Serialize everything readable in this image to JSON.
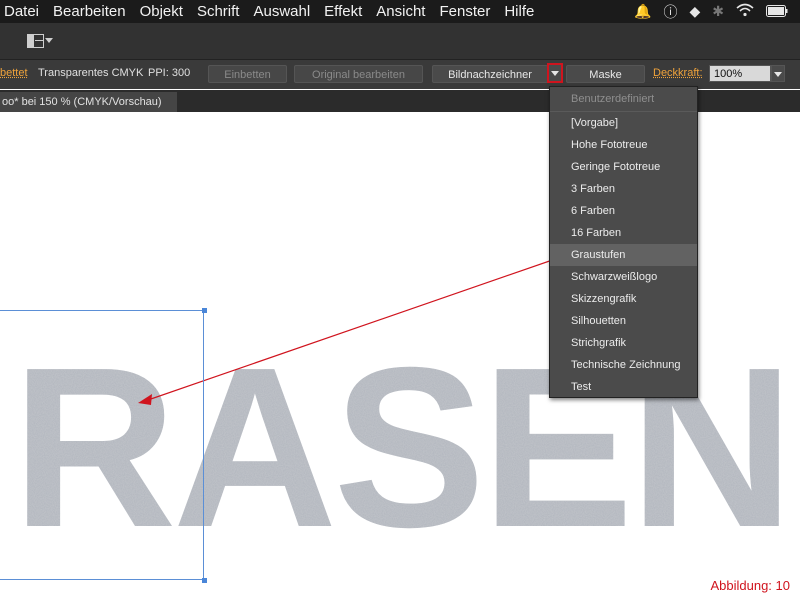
{
  "menubar": {
    "items": [
      "Datei",
      "Bearbeiten",
      "Objekt",
      "Schrift",
      "Auswahl",
      "Effekt",
      "Ansicht",
      "Fenster",
      "Hilfe"
    ],
    "system_icons": [
      "bell-icon",
      "info-icon",
      "dropbox-icon",
      "bluetooth-icon",
      "wifi-icon",
      "battery-icon"
    ]
  },
  "control_bar": {
    "embedded_label": "bettet",
    "color_mode": "Transparentes CMYK",
    "ppi": "PPI: 300",
    "embed_button": "Einbetten",
    "edit_original_button": "Original bearbeiten",
    "trace_button": "Bildnachzeichner",
    "mask_button": "Maske",
    "opacity_label": "Deckkraft:",
    "opacity_value": "100%"
  },
  "document_tab": {
    "title": "oo* bei 150 % (CMYK/Vorschau)"
  },
  "dropdown": {
    "header": "Benutzerdefiniert",
    "items": [
      "[Vorgabe]",
      "Hohe Fototreue",
      "Geringe Fototreue",
      "3 Farben",
      "6 Farben",
      "16 Farben",
      "Graustufen",
      "Schwarzweißlogo",
      "Skizzengrafik",
      "Silhouetten",
      "Strichgrafik",
      "Technische Zeichnung",
      "Test"
    ],
    "highlighted": "Graustufen"
  },
  "canvas": {
    "text": "RASEN"
  },
  "caption": "Abbildung: 10",
  "colors": {
    "accent_orange": "#f0a33a",
    "highlight_red": "#d0141e",
    "selection_blue": "#4a86d8"
  }
}
